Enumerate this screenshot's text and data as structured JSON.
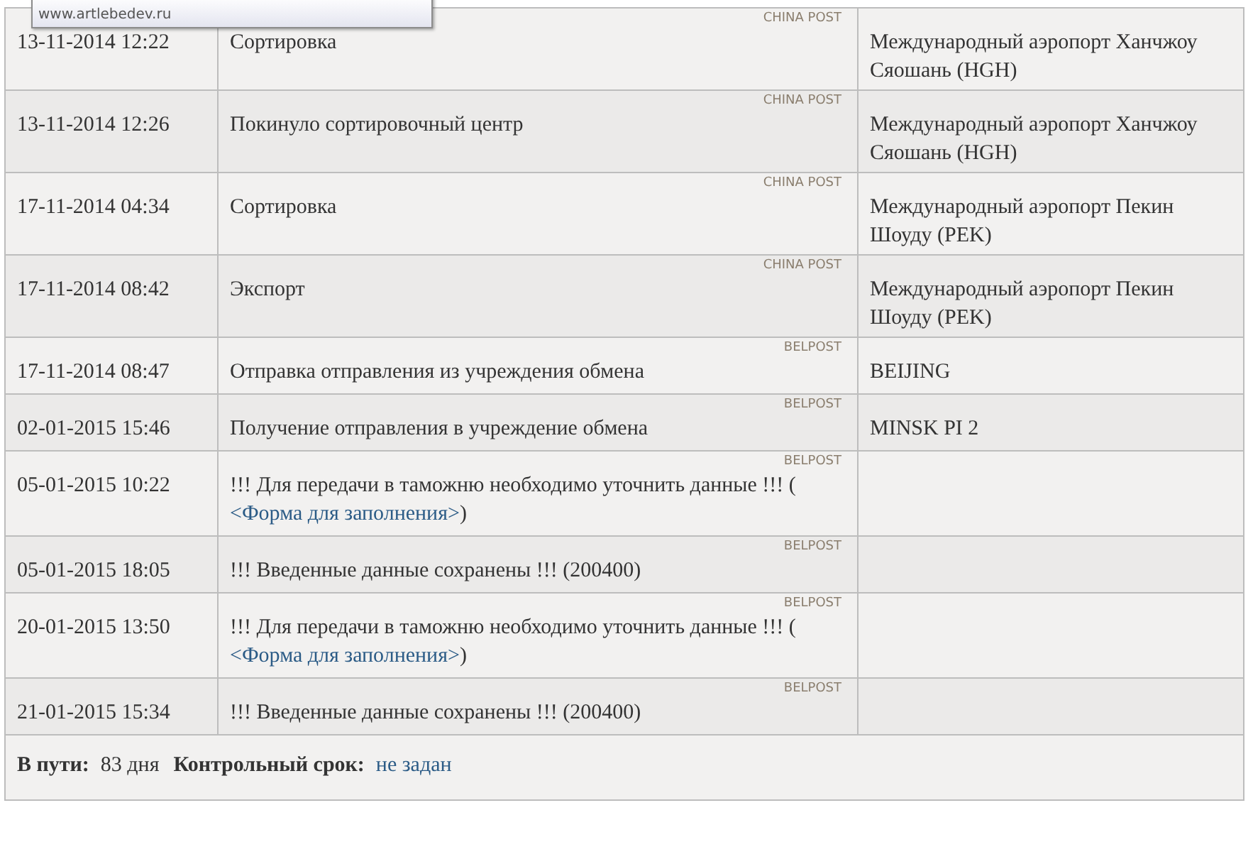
{
  "tooltip": {
    "url": "www.artlebedev.ru"
  },
  "rows": [
    {
      "date": "13-11-2014 12:22",
      "operator": "CHINA POST",
      "event": "Сортировка",
      "place": "Международный аэропорт Ханчжоу Сяошань (HGH)"
    },
    {
      "date": "13-11-2014 12:26",
      "operator": "CHINA POST",
      "event": "Покинуло сортировочный центр",
      "place": "Международный аэропорт Ханчжоу Сяошань (HGH)"
    },
    {
      "date": "17-11-2014 04:34",
      "operator": "CHINA POST",
      "event": "Сортировка",
      "place": "Международный аэропорт Пекин Шоуду (PEK)"
    },
    {
      "date": "17-11-2014 08:42",
      "operator": "CHINA POST",
      "event": "Экспорт",
      "place": "Международный аэропорт Пекин Шоуду (PEK)"
    },
    {
      "date": "17-11-2014 08:47",
      "operator": "BELPOST",
      "event": "Отправка отправления из учреждения обмена",
      "place": "BEIJING"
    },
    {
      "date": "02-01-2015 15:46",
      "operator": "BELPOST",
      "event": "Получение отправления в учреждение обмена",
      "place": "MINSK PI 2"
    },
    {
      "date": "05-01-2015 10:22",
      "operator": "BELPOST",
      "event": "!!! Для передачи в таможню необходимо уточнить данные !!! (",
      "link": "<Форма для заполнения>",
      "event_end": ")"
    },
    {
      "date": "05-01-2015 18:05",
      "operator": "BELPOST",
      "event": "!!! Введенные данные сохранены !!! (200400)"
    },
    {
      "date": "20-01-2015 13:50",
      "operator": "BELPOST",
      "event": "!!! Для передачи в таможню необходимо уточнить данные !!! (",
      "link": "<Форма для заполнения>",
      "event_end": ")"
    },
    {
      "date": "21-01-2015 15:34",
      "operator": "BELPOST",
      "event": "!!! Введенные данные сохранены !!! (200400)"
    }
  ],
  "footer": [
    {
      "label": "В пути:",
      "value": "83 дня",
      "kind": "text"
    },
    {
      "label": "Контрольный срок:",
      "value": "не задан",
      "kind": "link"
    }
  ]
}
